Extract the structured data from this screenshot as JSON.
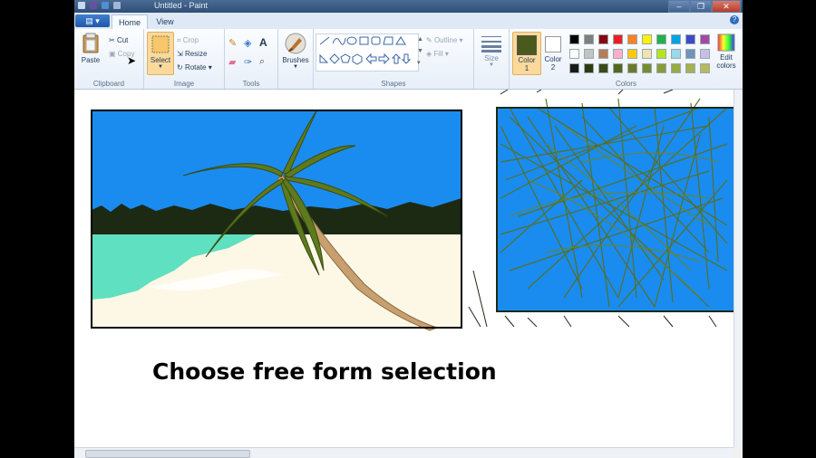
{
  "window": {
    "title": "Untitled - Paint"
  },
  "tabs": {
    "file_label": "▤ ▾",
    "home": "Home",
    "view": "View",
    "help_icon": "?"
  },
  "clipboard": {
    "paste": "Paste",
    "cut": "Cut",
    "copy": "Copy",
    "group": "Clipboard"
  },
  "image": {
    "select": "Select",
    "crop": "Crop",
    "resize": "Resize",
    "rotate": "Rotate",
    "group": "Image"
  },
  "tools": {
    "group": "Tools",
    "text_icon": "A"
  },
  "brushes": {
    "label": "Brushes"
  },
  "shapes": {
    "outline": "Outline",
    "fill": "Fill",
    "group": "Shapes"
  },
  "size": {
    "label": "Size"
  },
  "colors": {
    "color1": "Color 1",
    "color2": "Color 2",
    "edit": "Edit colors",
    "group": "Colors",
    "color1_value": "#4a5a1c",
    "color2_value": "#ffffff",
    "palette_row1": [
      "#000000",
      "#7f7f7f",
      "#880015",
      "#ed1c24",
      "#ff7f27",
      "#fff200",
      "#22b14c",
      "#00a2e8",
      "#3f48cc",
      "#a349a4"
    ],
    "palette_row2": [
      "#ffffff",
      "#c3c3c3",
      "#b97a57",
      "#ffaec9",
      "#ffc90e",
      "#efe4b0",
      "#b5e61d",
      "#99d9ea",
      "#7092be",
      "#c8bfe7"
    ],
    "palette_row3": [
      "#1a1a1a",
      "#2e3a12",
      "#3d4a1a",
      "#55661f",
      "#6b7a2a",
      "#7a8a30",
      "#8a9a3a",
      "#9aaa45",
      "#a8b050",
      "#b8b860"
    ]
  },
  "caption": "Choose free form selection"
}
